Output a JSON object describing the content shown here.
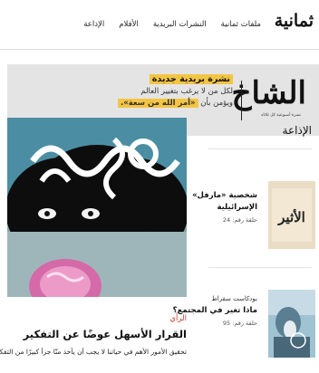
{
  "header": {
    "logo": "ثمانية",
    "nav": [
      "الإذاعة",
      "الأفلام",
      "النشرات البريدية",
      "ملفات ثمانية"
    ]
  },
  "banner": {
    "brand": "الشاخ",
    "brand_subtitle": "نشرة أسبوعية كل ثلاثاء",
    "headline": "نشرة بريدية جديدة",
    "line2": "لكل من لا يرغب بتغيير العالم",
    "line3_prefix": "ويؤمن بأن",
    "line3_highlight": "«أمر الله من سعة»."
  },
  "article": {
    "tag": "الرأي",
    "title": "القرار الأسهل عوضًا عن التفكير",
    "excerpt": "تحقيق الأمور الأهم في حياتنا لا يجب أن يأخذ منّا جزأً كبيرًا من التفكير، لهذا"
  },
  "sidebar": {
    "section_title": "الإذاعة",
    "items": [
      {
        "kicker": "",
        "title": "شخصية «مارفل» الإسرائيلية",
        "meta": "حلقة رقم: 24",
        "thumb_text": "الأثير"
      },
      {
        "kicker": "بودكاست سقراط",
        "title": "ماذا تغير في المجتمع؟",
        "meta": "حلقة رقم: 95",
        "thumb_text": ""
      }
    ]
  },
  "colors": {
    "accent_yellow": "#f4c542",
    "opinion_red": "#c0392b",
    "banner_bg": "#e4e4e4"
  }
}
